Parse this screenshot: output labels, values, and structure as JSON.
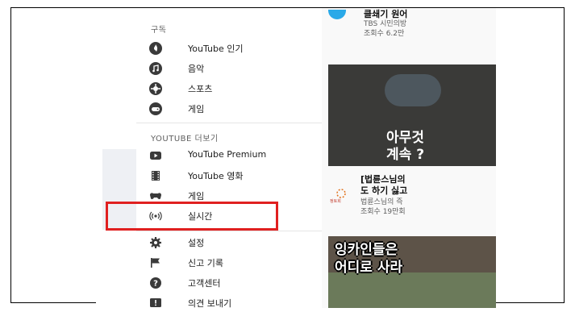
{
  "sidebar": {
    "subscriptions_heading": "구독",
    "subscriptions": [
      {
        "label": "YouTube 인기",
        "icon": "trending-icon"
      },
      {
        "label": "음악",
        "icon": "music-icon"
      },
      {
        "label": "스포츠",
        "icon": "sports-icon"
      },
      {
        "label": "게임",
        "icon": "gaming-icon"
      }
    ],
    "more_heading": "YOUTUBE 더보기",
    "more": [
      {
        "label": "YouTube Premium",
        "icon": "youtube-premium-icon"
      },
      {
        "label": "YouTube 영화",
        "icon": "movies-icon"
      },
      {
        "label": "게임",
        "icon": "gaming-icon"
      },
      {
        "label": "실시간",
        "icon": "live-icon"
      }
    ],
    "settings": [
      {
        "label": "설정",
        "icon": "gear-icon"
      },
      {
        "label": "신고 기록",
        "icon": "flag-icon"
      },
      {
        "label": "고객센터",
        "icon": "help-icon"
      },
      {
        "label": "의견 보내기",
        "icon": "feedback-icon"
      }
    ]
  },
  "videos": [
    {
      "title": "클쇄기 원어",
      "channel": "TBS 시민의방",
      "views": "조회수 6.2만"
    },
    {
      "thumb_line1": "아무것",
      "thumb_line2": "계속 ?",
      "title_line1": "[법륜스님의",
      "title_line2": "도 하기 싫고",
      "channel": "법륜스님의 즉",
      "views": "조회수 19만회",
      "channel_logo_text": "정토회"
    },
    {
      "thumb_line1": "잉카인들은",
      "thumb_line2": "어디로 사라"
    }
  ],
  "colors": {
    "highlight": "#e02020",
    "accent": "#2aa9e8"
  }
}
